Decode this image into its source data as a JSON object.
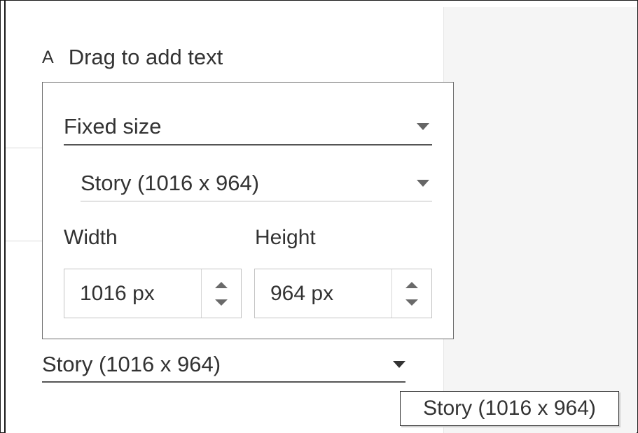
{
  "text_object": {
    "icon": "text-A-icon",
    "glyph": "A",
    "label": "Drag to add text"
  },
  "size_popup": {
    "mode_select": {
      "value": "Fixed size",
      "icon": "caret-down-icon"
    },
    "preset_select": {
      "value": "Story (1016 x 964)",
      "icon": "caret-down-icon"
    },
    "width": {
      "label": "Width",
      "value": "1016 px"
    },
    "height": {
      "label": "Height",
      "value": "964 px"
    }
  },
  "size_dropdown": {
    "value": "Story (1016 x 964)",
    "icon": "caret-down-icon"
  },
  "tooltip": {
    "text": "Story (1016 x 964)"
  },
  "colors": {
    "panel_right": "#f5f5f5",
    "text": "#333333",
    "border": "#6e6e6e"
  }
}
